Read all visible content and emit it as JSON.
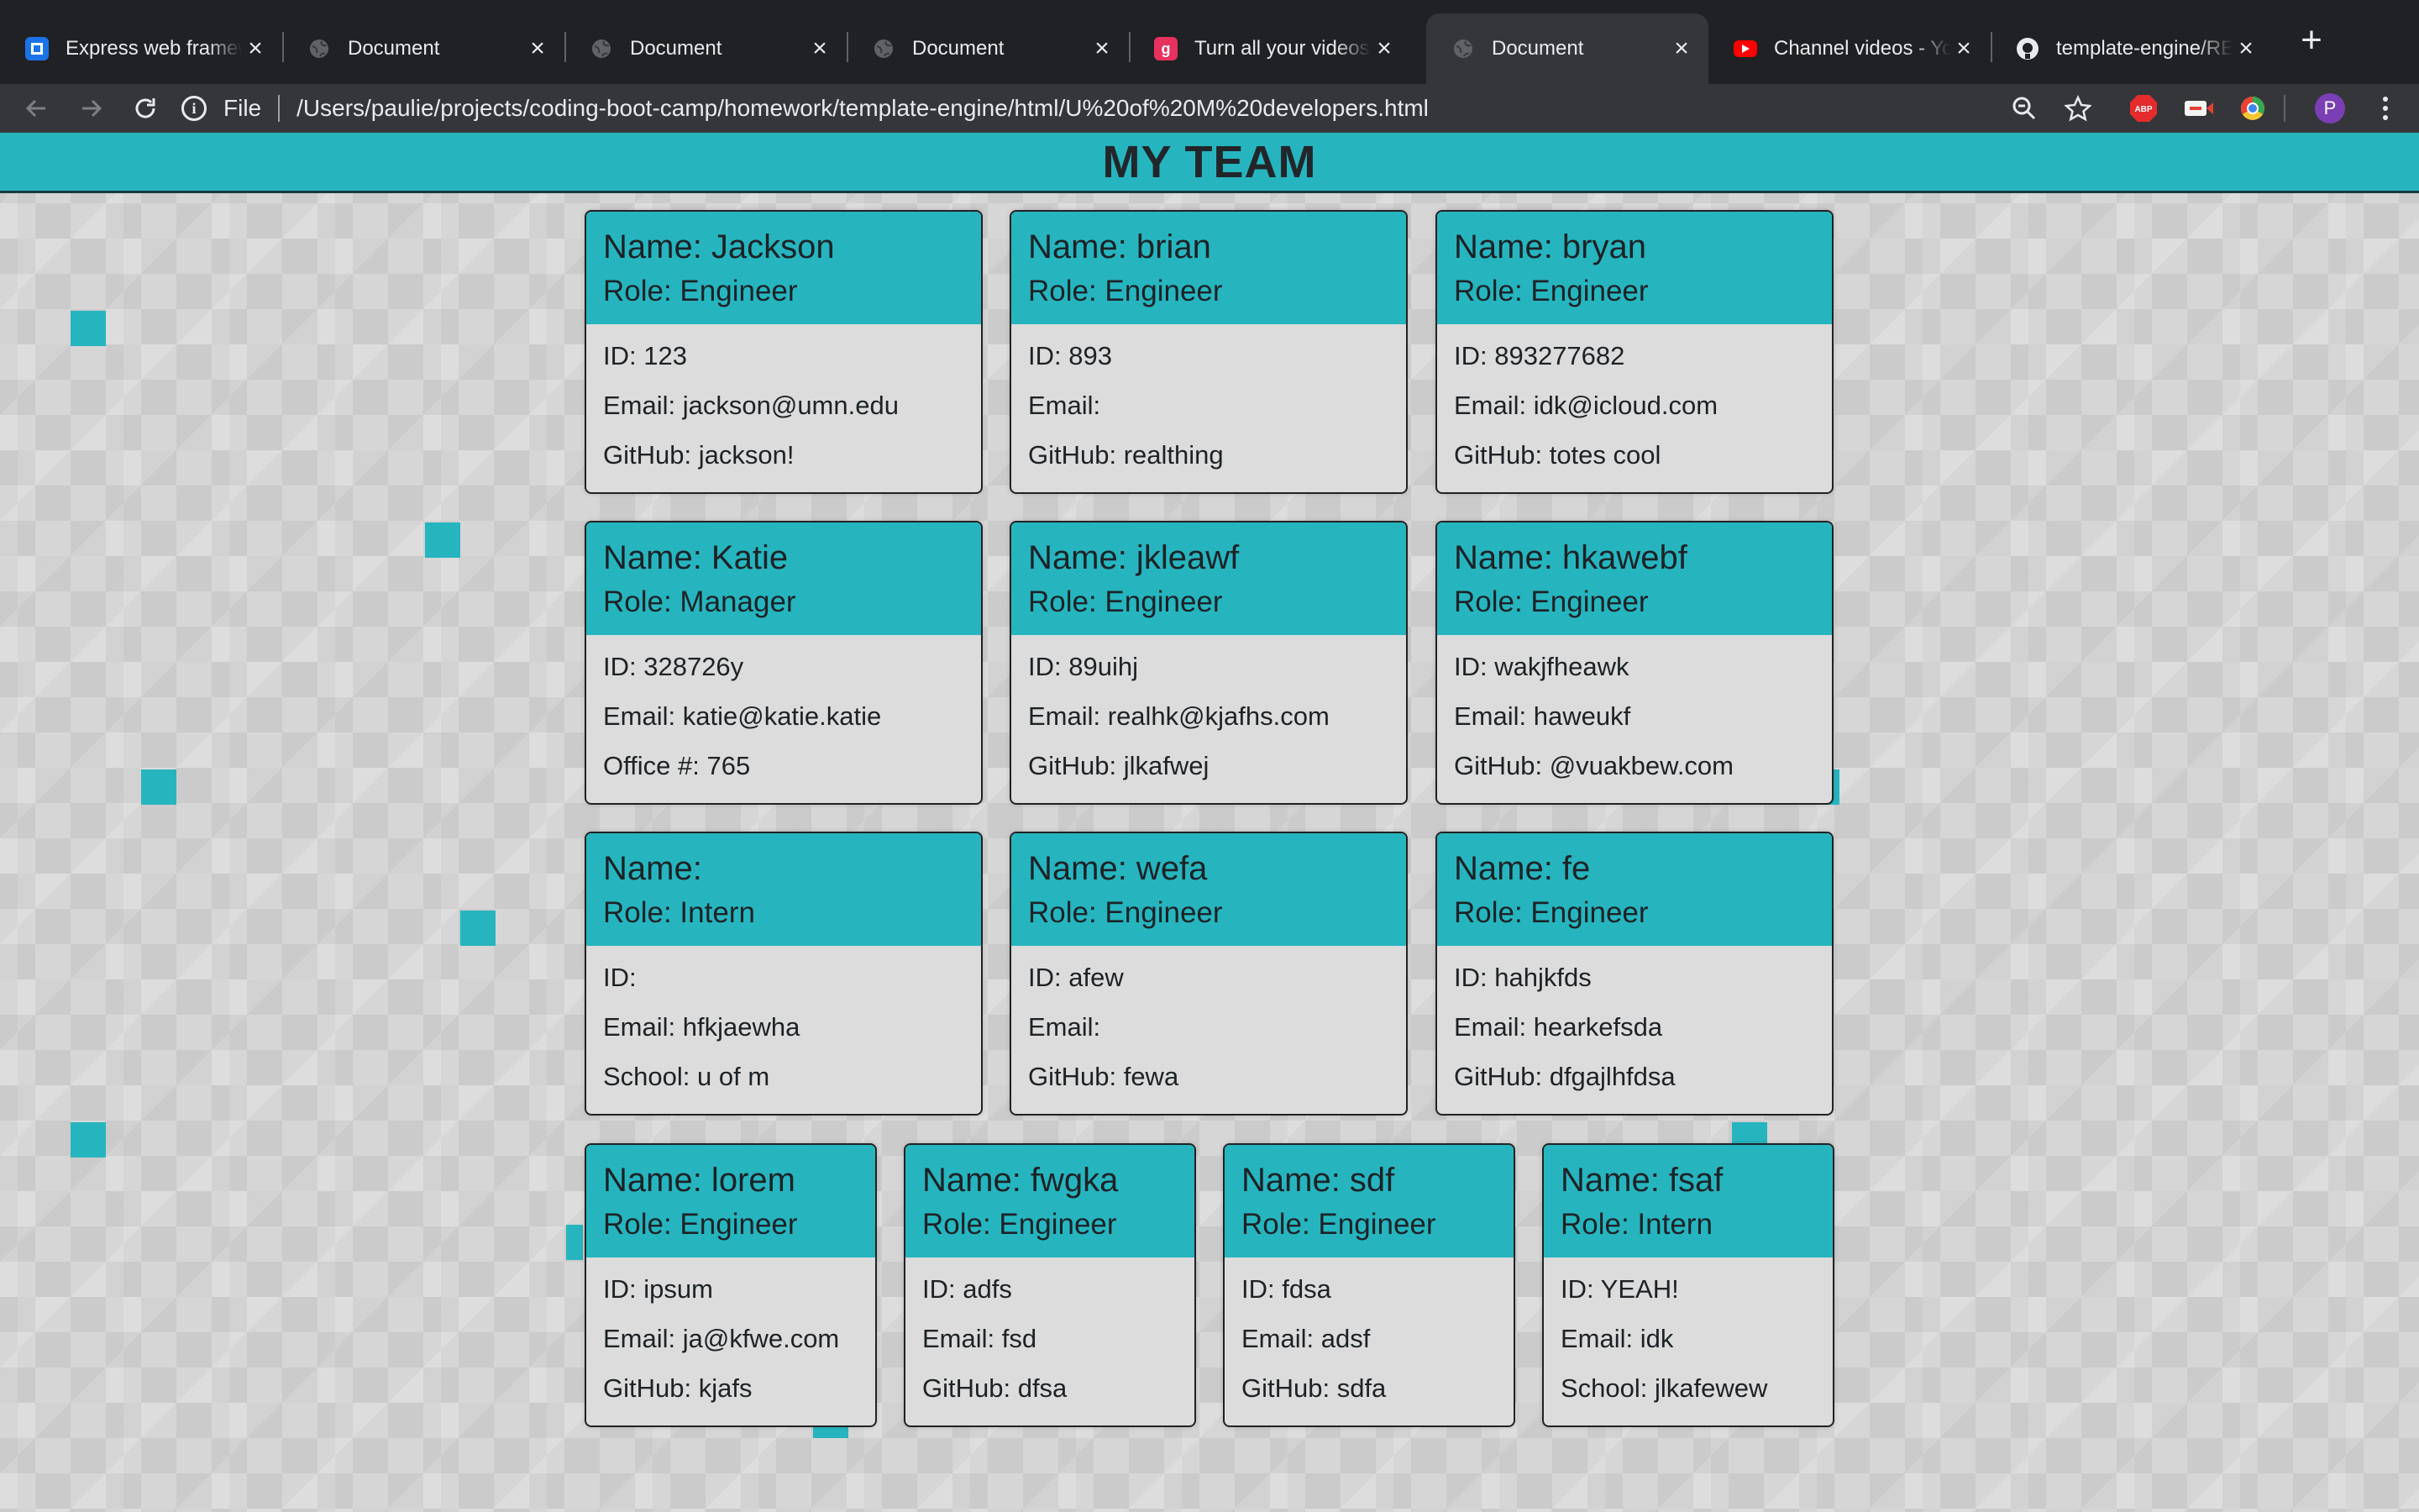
{
  "browser": {
    "tabs": [
      {
        "title": "Express web framework",
        "favicon": "express-logo-icon",
        "favicon_color": "#1a73e8",
        "active": false
      },
      {
        "title": "Document",
        "favicon": "globe-icon",
        "active": false
      },
      {
        "title": "Document",
        "favicon": "globe-icon",
        "active": false
      },
      {
        "title": "Document",
        "favicon": "globe-icon",
        "active": false
      },
      {
        "title": "Turn all your videos",
        "favicon": "g-logo-icon",
        "favicon_color": "#e8315f",
        "active": false
      },
      {
        "title": "Document",
        "favicon": "globe-icon",
        "active": true
      },
      {
        "title": "Channel videos - YouTube",
        "favicon": "youtube-icon",
        "favicon_color": "#ff0000",
        "active": false
      },
      {
        "title": "template-engine/README",
        "favicon": "github-icon",
        "active": false
      }
    ],
    "omnibox": {
      "scheme_label": "File",
      "url": "/Users/paulie/projects/coding-boot-camp/homework/template-engine/html/U%20of%20M%20developers.html"
    },
    "profile_initial": "P",
    "colors": {
      "tabstrip": "#202124",
      "toolbar": "#35363a",
      "text": "#e8eaed"
    }
  },
  "page": {
    "title": "MY TEAM",
    "colors": {
      "accent": "#26b5bf",
      "card_bg": "#dcdcdc",
      "page_bg": "#d6d6d6"
    },
    "cards": [
      {
        "name": "Name: Jackson",
        "role": "Role: Engineer",
        "lines": [
          "ID: 123",
          "Email: jackson@umn.edu",
          "GitHub: jackson!"
        ]
      },
      {
        "name": "Name: brian",
        "role": "Role: Engineer",
        "lines": [
          "ID: 893",
          "Email:",
          "GitHub: realthing"
        ]
      },
      {
        "name": "Name: bryan",
        "role": "Role: Engineer",
        "lines": [
          "ID: 893277682",
          "Email: idk@icloud.com",
          "GitHub: totes cool"
        ]
      },
      {
        "name": "Name: Katie",
        "role": "Role: Manager",
        "lines": [
          "ID: 328726y",
          "Email: katie@katie.katie",
          "Office #: 765"
        ]
      },
      {
        "name": "Name: jkleawf",
        "role": "Role: Engineer",
        "lines": [
          "ID: 89uihj",
          "Email: realhk@kjafhs.com",
          "GitHub: jlkafwej"
        ]
      },
      {
        "name": "Name: hkawebf",
        "role": "Role: Engineer",
        "lines": [
          "ID: wakjfheawk",
          "Email: haweukf",
          "GitHub: @vuakbew.com"
        ]
      },
      {
        "name": "Name:",
        "role": "Role: Intern",
        "lines": [
          "ID:",
          "Email: hfkjaewha",
          "School: u of m"
        ]
      },
      {
        "name": "Name: wefa",
        "role": "Role: Engineer",
        "lines": [
          "ID: afew",
          "Email:",
          "GitHub: fewa"
        ]
      },
      {
        "name": "Name: fe",
        "role": "Role: Engineer",
        "lines": [
          "ID: hahjkfds",
          "Email: hearkefsda",
          "GitHub: dfgajlhfdsa"
        ]
      },
      {
        "name": "Name: lorem",
        "role": "Role: Engineer",
        "lines": [
          "ID: ipsum",
          "Email: ja@kfwe.com",
          "GitHub: kjafs"
        ]
      },
      {
        "name": "Name: fwgka",
        "role": "Role: Engineer",
        "lines": [
          "ID: adfs",
          "Email: fsd",
          "GitHub: dfsa"
        ]
      },
      {
        "name": "Name: sdf",
        "role": "Role: Engineer",
        "lines": [
          "ID: fdsa",
          "Email: adsf",
          "GitHub: sdfa"
        ]
      },
      {
        "name": "Name: fsaf",
        "role": "Role: Intern",
        "lines": [
          "ID: YEAH!",
          "Email: idk",
          "School: jlkafewew"
        ]
      }
    ]
  }
}
